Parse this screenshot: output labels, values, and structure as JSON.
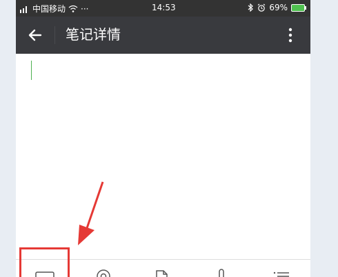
{
  "status_bar": {
    "carrier": "中国移动",
    "signal_label": "᠀ıl",
    "more": "···",
    "time": "14:53",
    "battery": "69%"
  },
  "title_bar": {
    "title": "笔记详情"
  },
  "icons": {
    "back": "arrow-left-icon",
    "more": "vertical-dots-icon",
    "keyboard": "keyboard-icon",
    "mention": "at-sign-icon",
    "file": "file-icon",
    "microphone": "microphone-icon",
    "list": "list-icon"
  },
  "colors": {
    "status_bar": "#333333",
    "title_bar": "#393a3e",
    "cursor": "#4caf50",
    "annotation": "#e53935"
  }
}
